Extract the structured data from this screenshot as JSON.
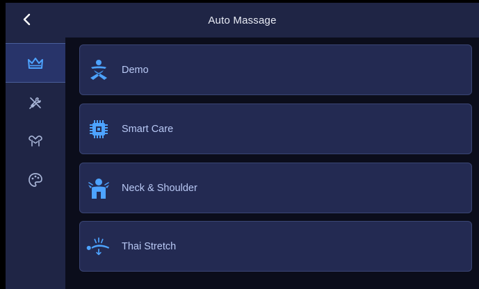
{
  "header": {
    "title": "Auto Massage",
    "back_icon": "back-arrow-icon"
  },
  "sidebar": {
    "items": [
      {
        "name": "crown",
        "icon": "crown-icon",
        "active": true
      },
      {
        "name": "tools",
        "icon": "wrench-screwdriver-icon",
        "active": false
      },
      {
        "name": "body",
        "icon": "torso-icon",
        "active": false
      },
      {
        "name": "palette",
        "icon": "palette-icon",
        "active": false
      }
    ]
  },
  "programs": [
    {
      "label": "Demo",
      "icon": "person-meditation-icon"
    },
    {
      "label": "Smart Care",
      "icon": "chip-icon"
    },
    {
      "label": "Neck & Shoulder",
      "icon": "neck-shoulder-icon"
    },
    {
      "label": "Thai Stretch",
      "icon": "stretch-icon"
    }
  ],
  "colors": {
    "header_bg": "#1f2545",
    "card_bg": "#232a52",
    "accent": "#4da3ff",
    "text": "#b9c9f5"
  }
}
